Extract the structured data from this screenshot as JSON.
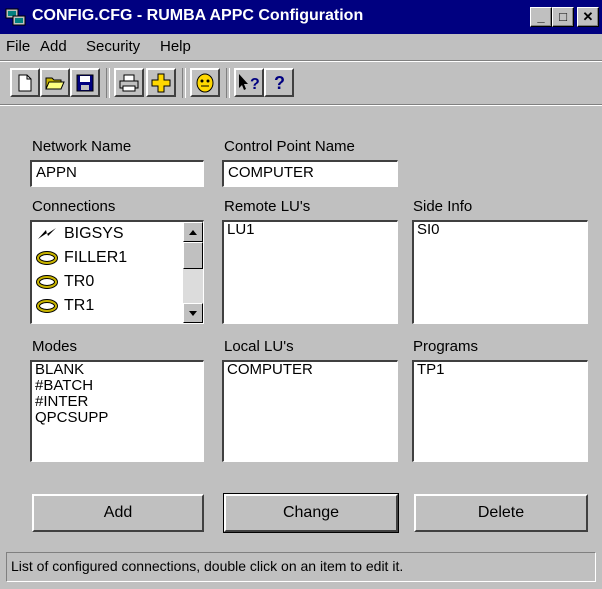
{
  "window": {
    "title": "CONFIG.CFG - RUMBA APPC Configuration"
  },
  "title_buttons": {
    "minimize": "_",
    "maximize": "□",
    "close": "✕"
  },
  "menu": [
    "File",
    "Add",
    "Security",
    "Help"
  ],
  "toolbar": {
    "buttons": [
      "new",
      "open",
      "save",
      "print",
      "add",
      "security",
      "context-help",
      "help"
    ],
    "context_help_label": "?",
    "help_label": "?"
  },
  "network_name": {
    "label": "Network Name",
    "value": "APPN"
  },
  "control_point_name": {
    "label": "Control Point Name",
    "value": "COMPUTER"
  },
  "connections": {
    "label": "Connections",
    "items": [
      {
        "name": "BIGSYS",
        "icon": "bolt-icon"
      },
      {
        "name": "FILLER1",
        "icon": "ring-icon"
      },
      {
        "name": "TR0",
        "icon": "ring-icon"
      },
      {
        "name": "TR1",
        "icon": "ring-icon"
      }
    ]
  },
  "remote_lus": {
    "label": "Remote LU's",
    "items": [
      "LU1"
    ]
  },
  "side_info": {
    "label": "Side Info",
    "items": [
      "SI0"
    ]
  },
  "modes": {
    "label": "Modes",
    "items": [
      "BLANK",
      "#BATCH",
      "#INTER",
      "QPCSUPP"
    ]
  },
  "local_lus": {
    "label": "Local LU's",
    "items": [
      "COMPUTER"
    ]
  },
  "programs": {
    "label": "Programs",
    "items": [
      "TP1"
    ]
  },
  "buttons": {
    "add": "Add",
    "change": "Change",
    "delete": "Delete"
  },
  "status": "List of configured connections, double click on an item to edit it.",
  "colors": {
    "titlebar": "#000080",
    "face": "#c0c0c0",
    "ring": "#c8b400"
  }
}
